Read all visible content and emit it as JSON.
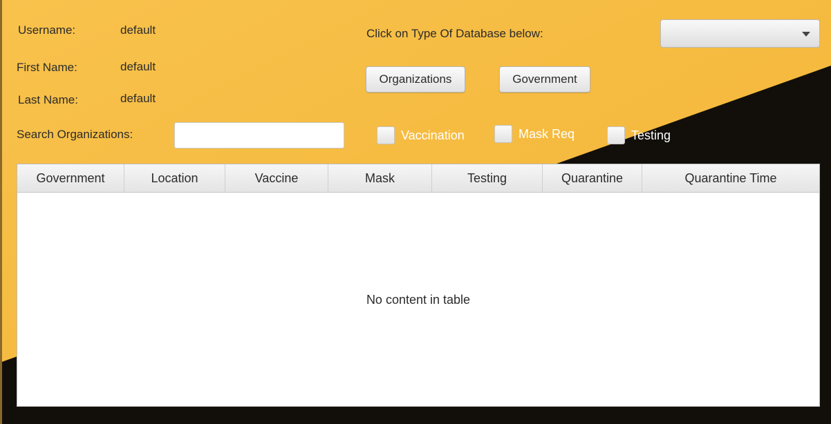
{
  "user": {
    "username_label": "Username:",
    "username_value": "default",
    "first_name_label": "First Name:",
    "first_name_value": "default",
    "last_name_label": "Last Name:",
    "last_name_value": "default"
  },
  "database": {
    "prompt": "Click on Type Of Database below:",
    "selected": "",
    "organizations_button": "Organizations",
    "government_button": "Government"
  },
  "search": {
    "label": "Search Organizations:",
    "value": ""
  },
  "filters": {
    "vaccination": "Vaccination",
    "mask_req": "Mask Req",
    "testing": "Testing"
  },
  "table": {
    "columns": [
      "Government",
      "Location",
      "Vaccine",
      "Mask",
      "Testing",
      "Quarantine",
      "Quarantine Time"
    ],
    "empty_message": "No content in table"
  },
  "colors": {
    "background_gold": "#f7bf45",
    "background_dark": "#120f0b",
    "checkbox_label": "#ffffff"
  }
}
